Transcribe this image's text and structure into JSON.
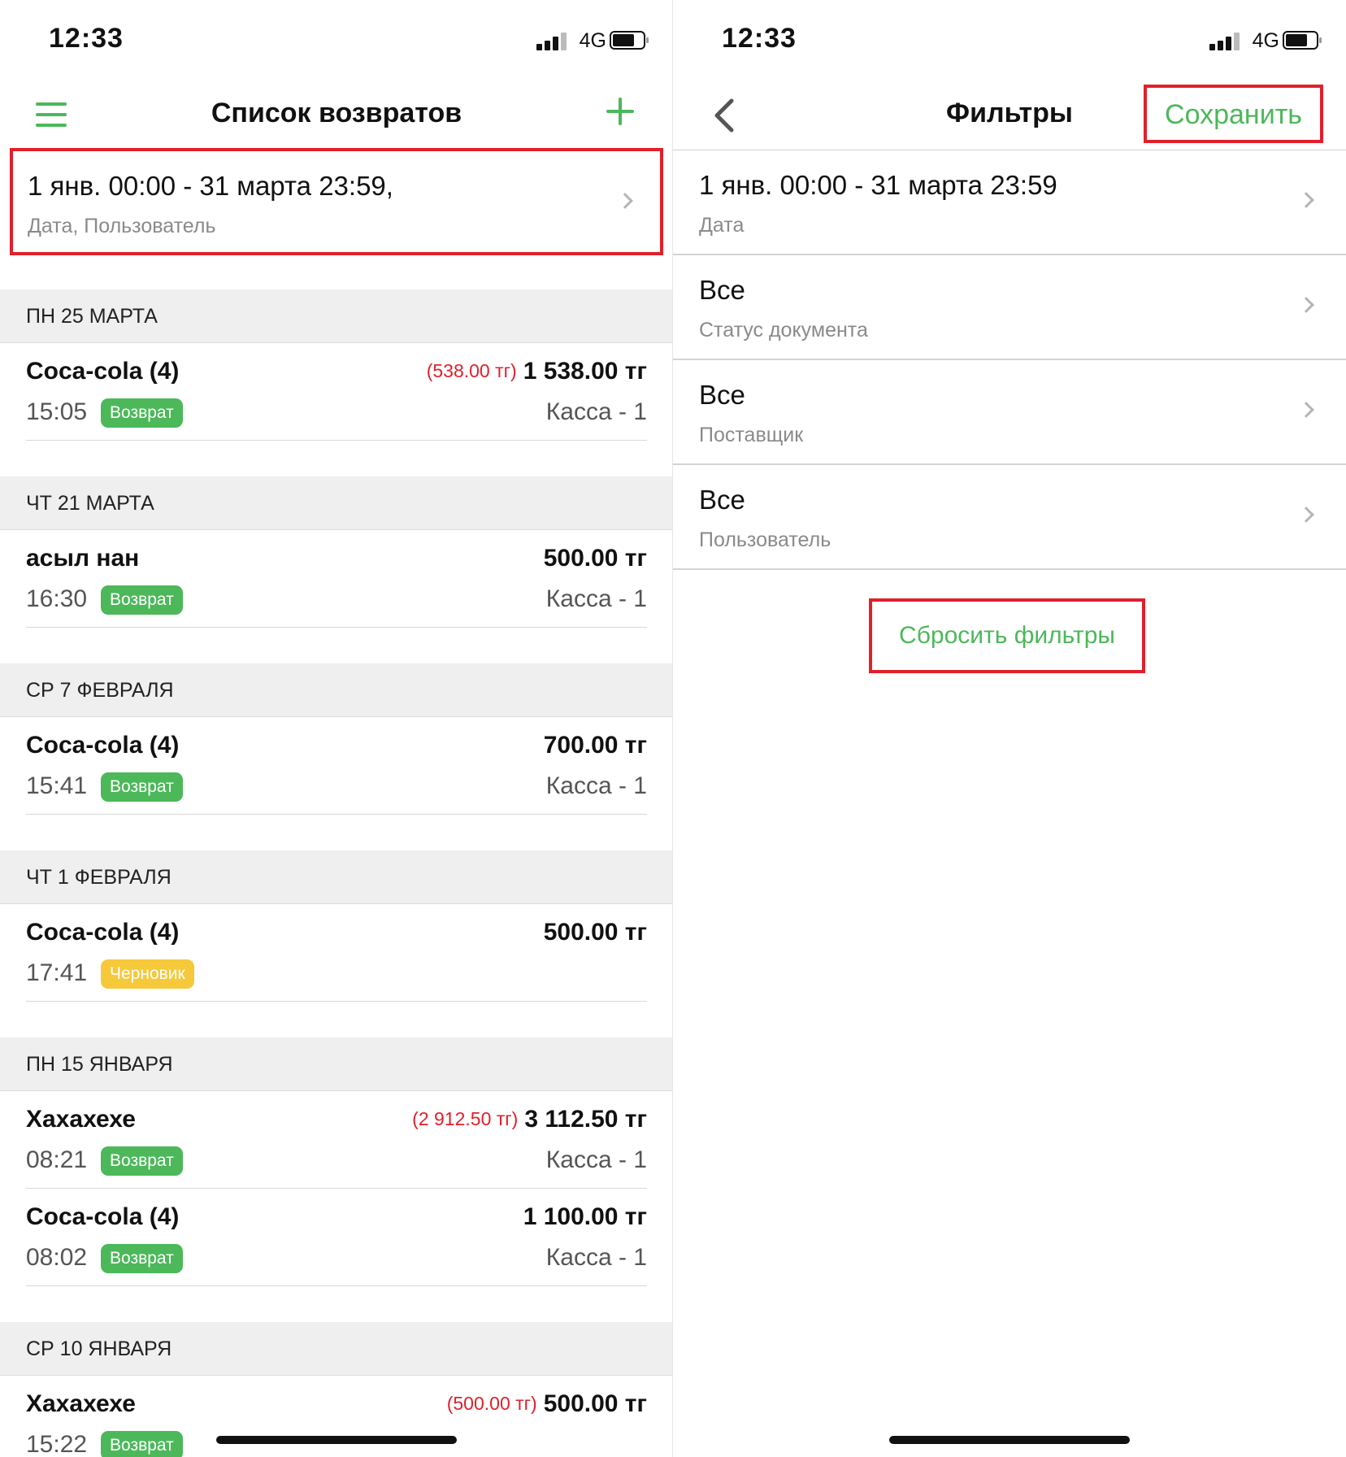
{
  "left": {
    "status": {
      "time": "12:33",
      "network": "4G"
    },
    "nav": {
      "title": "Список возвратов"
    },
    "filter_summary": {
      "main": "1 янв. 00:00 - 31 марта 23:59,",
      "sub": "Дата, Пользователь"
    },
    "sections": [
      {
        "header": "ПН 25 МАРТА",
        "rows": [
          {
            "name": "Coca-cola (4)",
            "neg": "(538.00 тг)",
            "amount": "1 538.00 тг",
            "time": "15:05",
            "badge": "Возврат",
            "badge_color": "green",
            "kassa": "Касса - 1"
          }
        ]
      },
      {
        "header": "ЧТ 21 МАРТА",
        "rows": [
          {
            "name": "асыл нан",
            "neg": "",
            "amount": "500.00 тг",
            "time": "16:30",
            "badge": "Возврат",
            "badge_color": "green",
            "kassa": "Касса - 1"
          }
        ]
      },
      {
        "header": "СР 7 ФЕВРАЛЯ",
        "rows": [
          {
            "name": "Coca-cola (4)",
            "neg": "",
            "amount": "700.00 тг",
            "time": "15:41",
            "badge": "Возврат",
            "badge_color": "green",
            "kassa": "Касса - 1"
          }
        ]
      },
      {
        "header": "ЧТ 1 ФЕВРАЛЯ",
        "rows": [
          {
            "name": "Coca-cola (4)",
            "neg": "",
            "amount": "500.00 тг",
            "time": "17:41",
            "badge": "Черновик",
            "badge_color": "yellow",
            "kassa": ""
          }
        ]
      },
      {
        "header": "ПН 15 ЯНВАРЯ",
        "rows": [
          {
            "name": "Хахахехе",
            "neg": "(2 912.50 тг)",
            "amount": "3 112.50 тг",
            "time": "08:21",
            "badge": "Возврат",
            "badge_color": "green",
            "kassa": "Касса - 1"
          },
          {
            "name": "Coca-cola (4)",
            "neg": "",
            "amount": "1 100.00 тг",
            "time": "08:02",
            "badge": "Возврат",
            "badge_color": "green",
            "kassa": "Касса - 1"
          }
        ]
      },
      {
        "header": "СР 10 ЯНВАРЯ",
        "rows": [
          {
            "name": "Хахахехе",
            "neg": "(500.00 тг)",
            "amount": "500.00 тг",
            "time": "15:22",
            "badge": "Возврат",
            "badge_color": "green",
            "kassa": ""
          }
        ]
      }
    ]
  },
  "right": {
    "status": {
      "time": "12:33",
      "network": "4G"
    },
    "nav": {
      "title": "Фильтры",
      "save_label": "Сохранить"
    },
    "filters": [
      {
        "value": "1 янв. 00:00 - 31 марта 23:59",
        "label": "Дата"
      },
      {
        "value": "Все",
        "label": "Статус документа"
      },
      {
        "value": "Все",
        "label": "Поставщик"
      },
      {
        "value": "Все",
        "label": "Пользователь"
      }
    ],
    "reset_label": "Сбросить фильтры"
  },
  "colors": {
    "accent": "#4cb85a",
    "highlight": "#e0202b",
    "draft": "#f6c93b",
    "negative": "#e0202b"
  }
}
